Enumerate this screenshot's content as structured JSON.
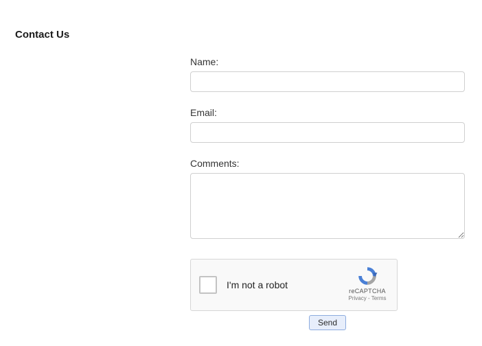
{
  "page": {
    "title": "Contact Us"
  },
  "form": {
    "name": {
      "label": "Name:",
      "value": ""
    },
    "email": {
      "label": "Email:",
      "value": ""
    },
    "comments": {
      "label": "Comments:",
      "value": ""
    }
  },
  "recaptcha": {
    "label": "I'm not a robot",
    "brand": "reCAPTCHA",
    "privacy": "Privacy",
    "separator": " - ",
    "terms": "Terms"
  },
  "actions": {
    "send": "Send"
  }
}
